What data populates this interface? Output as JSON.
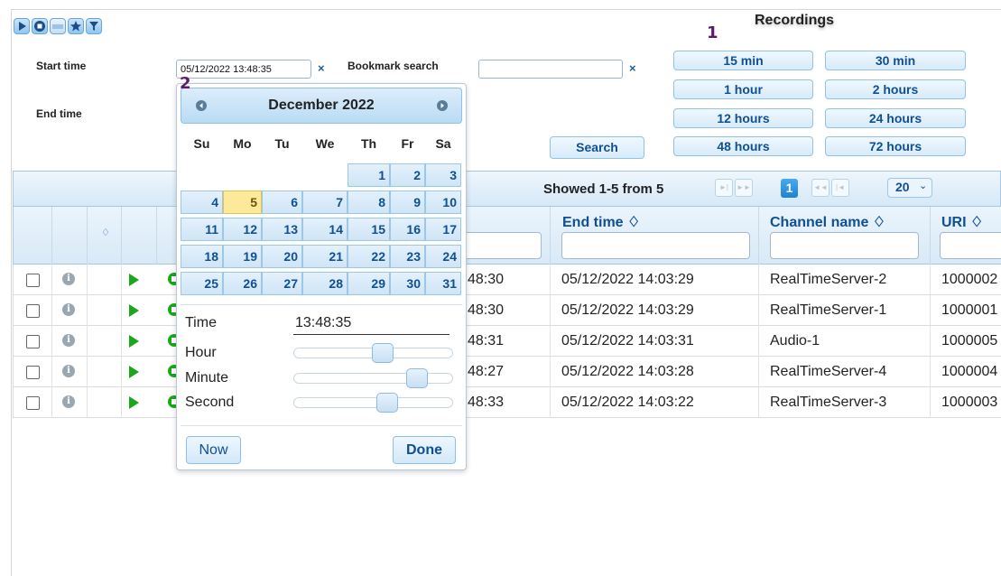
{
  "toolbar": {
    "buttons": [
      {
        "name": "play-icon"
      },
      {
        "name": "stop-icon"
      },
      {
        "name": "tape-icon"
      },
      {
        "name": "star-icon"
      },
      {
        "name": "filter-icon"
      }
    ]
  },
  "filters": {
    "start_time_label": "Start time",
    "start_time_value": "05/12/2022 13:48:35",
    "end_time_label": "End time",
    "bookmark_search_label": "Bookmark search",
    "bookmark_search_value": "",
    "clear_symbol": "×",
    "search_button": "Search"
  },
  "recordings": {
    "title": "Recordings",
    "buttons": [
      "15 min",
      "30 min",
      "1 hour",
      "2 hours",
      "12 hours",
      "24 hours",
      "48 hours",
      "72 hours"
    ]
  },
  "annotations": {
    "one": "1",
    "two": "2"
  },
  "grid": {
    "status": "Showed 1-5 from 5",
    "current_page": "1",
    "page_size": "20",
    "sort_indicator": "♢",
    "columns": {
      "end_time": "End time ♢",
      "channel_name": "Channel name ♢",
      "uri": "URI ♢"
    },
    "rows": [
      {
        "start_partial": "48:30",
        "end_time": "05/12/2022 14:03:29",
        "channel": "RealTimeServer-2",
        "uri": "1000002"
      },
      {
        "start_partial": "48:30",
        "end_time": "05/12/2022 14:03:29",
        "channel": "RealTimeServer-1",
        "uri": "1000001"
      },
      {
        "start_partial": "48:31",
        "end_time": "05/12/2022 14:03:31",
        "channel": "Audio-1",
        "uri": "1000005"
      },
      {
        "start_partial": "48:27",
        "end_time": "05/12/2022 14:03:28",
        "channel": "RealTimeServer-4",
        "uri": "1000004"
      },
      {
        "start_partial": "48:33",
        "end_time": "05/12/2022 14:03:22",
        "channel": "RealTimeServer-3",
        "uri": "1000003"
      }
    ]
  },
  "datepicker": {
    "month_year": "December 2022",
    "weekdays": [
      "Su",
      "Mo",
      "Tu",
      "We",
      "Th",
      "Fr",
      "Sa"
    ],
    "first_weekday_index": 4,
    "days_in_month": 31,
    "today": 5,
    "time_label": "Time",
    "time_value": "13:48:35",
    "hour_label": "Hour",
    "minute_label": "Minute",
    "second_label": "Second",
    "hour": 13,
    "minute": 48,
    "second": 35,
    "now_button": "Now",
    "done_button": "Done"
  },
  "colors": {
    "accent": "#0f4f95",
    "play": "#1aa81a",
    "today": "#fde99a",
    "annotation": "#5b1b6f"
  }
}
